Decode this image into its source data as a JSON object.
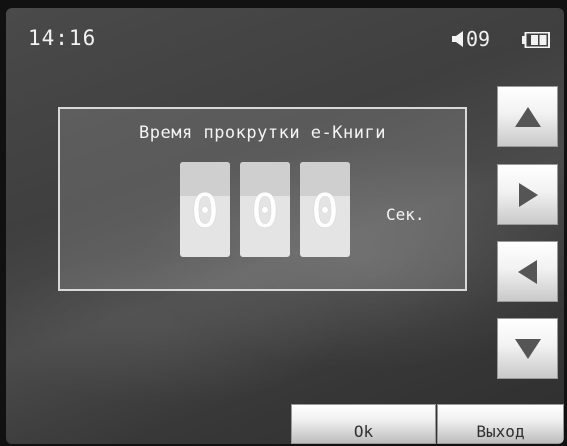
{
  "status_bar": {
    "time": "14:16",
    "volume": "09",
    "volume_icon": "speaker-icon",
    "battery_icon": "battery-icon"
  },
  "dialog": {
    "title": "Время прокрутки е-Книги",
    "digits": [
      "0",
      "0",
      "0"
    ],
    "unit": "Сек."
  },
  "nav_buttons": {
    "up_icon": "arrow-up-icon",
    "right_icon": "arrow-right-icon",
    "left_icon": "arrow-left-icon",
    "down_icon": "arrow-down-icon"
  },
  "actions": {
    "ok_label": "Ok",
    "exit_label": "Выход"
  }
}
